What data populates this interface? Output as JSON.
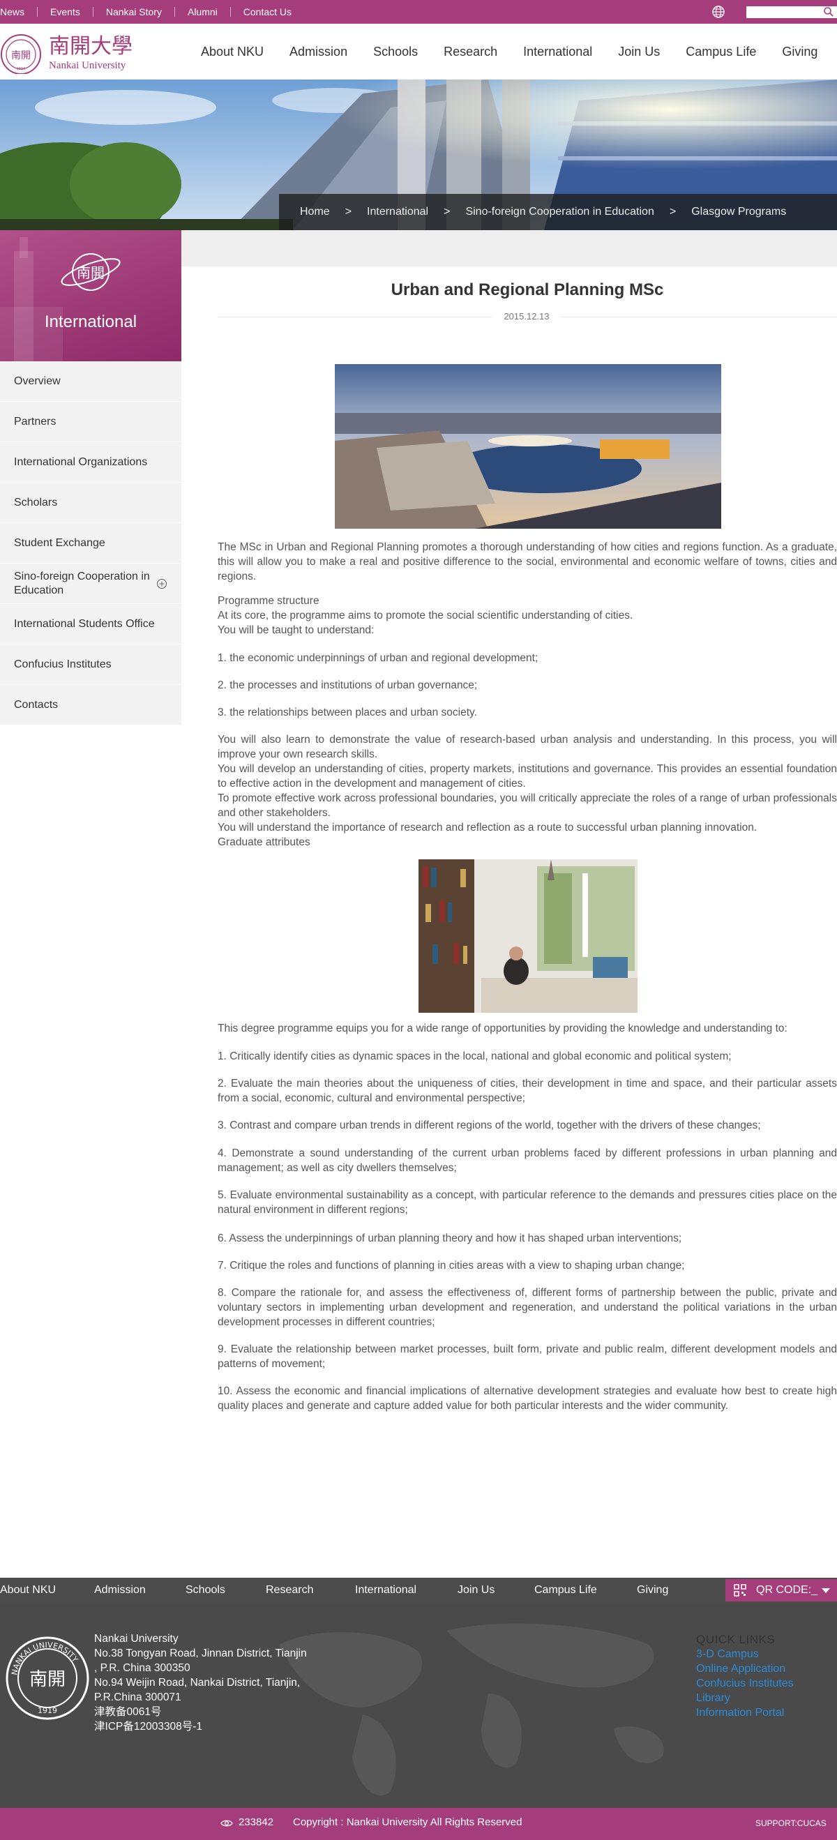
{
  "topbar": {
    "links": [
      "News",
      "Events",
      "Nankai Story",
      "Alumni",
      "Contact Us"
    ],
    "search_placeholder": ""
  },
  "header": {
    "logo_cn": "南開大學",
    "logo_en": "Nankai University",
    "nav": [
      "About NKU",
      "Admission",
      "Schools",
      "Research",
      "International",
      "Join Us",
      "Campus Life",
      "Giving"
    ]
  },
  "breadcrumb": [
    "Home",
    "International",
    "Sino-foreign Cooperation in Education",
    "Glasgow Programs"
  ],
  "breadcrumb_sep": ">",
  "sidebar": {
    "title": "International",
    "items": [
      "Overview",
      "Partners",
      "International Organizations",
      "Scholars",
      "Student Exchange",
      "Sino-foreign Cooperation in Education",
      "International Students Office",
      "Confucius Institutes",
      "Contacts"
    ]
  },
  "article": {
    "title": "Urban and Regional Planning MSc",
    "date": "2015.12.13",
    "intro": "The MSc in Urban and Regional Planning promotes a thorough understanding of how cities and regions function. As a graduate, this will allow you to make a real and positive difference to the social, environmental and economic welfare of towns, cities and regions.",
    "structure_lines": [
      "Programme structure",
      "At its core, the programme aims to promote the social scientific understanding of cities.",
      "You will be taught to understand:"
    ],
    "taught": [
      "1. the economic underpinnings of urban and regional development;",
      "2. the processes and institutions of urban governance;",
      "3. the relationships between places and urban society."
    ],
    "more_lines": [
      "You will also learn to demonstrate the value of research-based urban analysis and understanding. In this process, you will improve your own research skills.",
      "You will develop an understanding of cities, property markets, institutions and governance. This provides an essential foundation to effective action in the development and management of cities.",
      "To promote effective work across professional boundaries, you will critically appreciate the roles of a range of urban professionals and other stakeholders.",
      "You will understand the importance of research and reflection as a route to successful urban planning innovation.",
      "Graduate attributes"
    ],
    "equips": "This degree programme equips you for a wide range of opportunities by providing the knowledge and understanding to:",
    "outcomes": [
      "1. Critically identify cities as dynamic spaces in the local, national and global economic and political system;",
      "2. Evaluate the main theories about the uniqueness of cities, their development in time and space, and their particular assets from a social, economic, cultural and environmental perspective;",
      "3. Contrast and compare urban trends in different regions of the world, together with the drivers of these changes;",
      "4. Demonstrate a sound understanding of the current urban problems faced by different professions in urban planning and management; as well as city dwellers themselves;",
      "5. Evaluate environmental sustainability as a concept, with particular reference to the demands and pressures cities place on the natural environment in different regions;",
      "6. Assess the underpinnings of urban planning theory and how it has shaped urban interventions;",
      "7. Critique the roles and  functions of planning in cities areas with a view to shaping urban change;",
      "8. Compare the rationale for, and assess the effectiveness of, different forms of partnership between the public, private and voluntary sectors in implementing urban development and regeneration, and understand the political variations in the urban development processes in different countries;",
      "9. Evaluate the relationship between market processes, built form, private and public realm, different development models and patterns of movement;",
      "10. Assess the economic and financial implications of alternative development strategies and evaluate how best to create high quality places and generate and capture added value for both particular interests and the wider community."
    ]
  },
  "footer_nav": [
    "About NKU",
    "Admission",
    "Schools",
    "Research",
    "International",
    "Join Us",
    "Campus Life",
    "Giving"
  ],
  "qr_label": "QR CODE:_",
  "footer": {
    "address_lines": [
      "Nankai University",
      "No.38 Tongyan Road, Jinnan District, Tianjin",
      ", P.R. China 300350",
      "No.94 Weijin Road,  Nankai District, Tianjin,",
      "P.R.China  300071",
      "津教备0061号",
      "津ICP备12003308号-1"
    ],
    "quick_title": "QUICK LINKS",
    "quick_links": [
      "3-D Campus",
      "Online Application",
      "Confucius Institutes",
      "Library",
      "Information Portal"
    ]
  },
  "bottom": {
    "count": "233842",
    "copyright": "Copyright : Nankai University All Rights Reserved",
    "support": "SUPPORT:CUCAS"
  },
  "colors": {
    "brand": "#a53c7c",
    "link": "#2a8bd8",
    "footer_bg": "#4a4a4a"
  }
}
